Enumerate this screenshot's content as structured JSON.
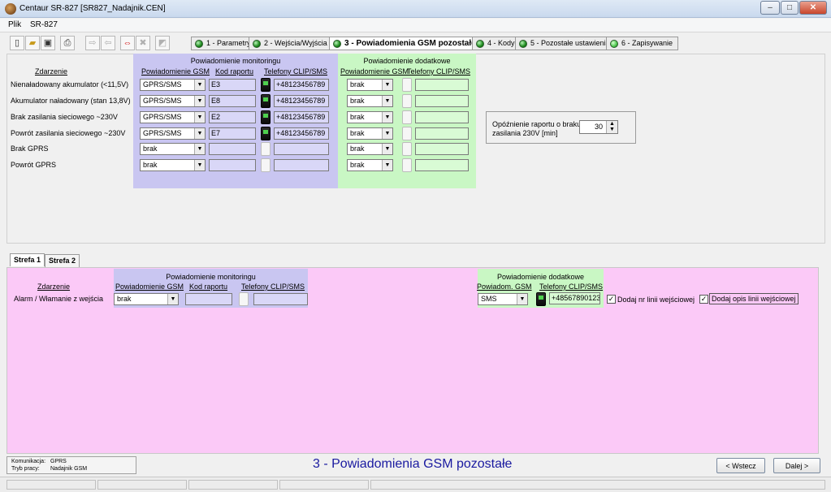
{
  "window": {
    "title": "Centaur SR-827  [SR827_Nadajnik.CEN]",
    "minimize": "–",
    "maximize": "□",
    "close": "✕"
  },
  "menu": [
    "Plik",
    "SR-827"
  ],
  "toolbar": {
    "icons": [
      "new-file-icon",
      "open-folder-icon",
      "save-icon",
      "print-icon",
      "copy-forward-icon",
      "copy-back-icon",
      "exchange-red-icon",
      "cross-gray-icon",
      "export-icon"
    ]
  },
  "steps": [
    {
      "label": "1 - Parametry",
      "active": false
    },
    {
      "label": "2 - Wejścia/Wyjścia",
      "active": false
    },
    {
      "label": "3 - Powiadomienia GSM pozostałe",
      "active": true
    },
    {
      "label": "4 - Kody",
      "active": false
    },
    {
      "label": "5 - Pozostałe ustawienia",
      "active": false
    },
    {
      "label": "6 - Zapisywanie",
      "active": false
    }
  ],
  "upper": {
    "event_header": "Zdarzenie",
    "monitoring_title": "Powiadomienie monitoringu",
    "monitoring_cols": [
      "Powiadomienie GSM",
      "Kod raportu",
      "Telefony CLIP/SMS"
    ],
    "extra_title": "Powiadomienie dodatkowe",
    "extra_cols": [
      "Powiadomienie GSM",
      "Telefony CLIP/SMS"
    ],
    "rows": [
      {
        "event": "Nienaładowany akumulator (<11,5V)",
        "gsm": "GPRS/SMS",
        "code": "E3",
        "phone_on": true,
        "phones": "+48123456789",
        "extra_gsm": "brak",
        "extra_phones": ""
      },
      {
        "event": "Akumulator naładowany (stan 13,8V)",
        "gsm": "GPRS/SMS",
        "code": "E8",
        "phone_on": true,
        "phones": "+48123456789",
        "extra_gsm": "brak",
        "extra_phones": ""
      },
      {
        "event": "Brak zasilania sieciowego ~230V",
        "gsm": "GPRS/SMS",
        "code": "E2",
        "phone_on": true,
        "phones": "+48123456789",
        "extra_gsm": "brak",
        "extra_phones": ""
      },
      {
        "event": "Powrót zasilania sieciowego ~230V",
        "gsm": "GPRS/SMS",
        "code": "E7",
        "phone_on": true,
        "phones": "+48123456789",
        "extra_gsm": "brak",
        "extra_phones": ""
      },
      {
        "event": "Brak GPRS",
        "gsm": "brak",
        "code": "",
        "phone_on": false,
        "phones": "",
        "extra_gsm": "brak",
        "extra_phones": ""
      },
      {
        "event": "Powrót GPRS",
        "gsm": "brak",
        "code": "",
        "phone_on": false,
        "phones": "",
        "extra_gsm": "brak",
        "extra_phones": ""
      }
    ],
    "delay_label": "Opóźnienie raportu o braku zasilania 230V [min]",
    "delay_value": "30"
  },
  "zones": {
    "tabs": [
      "Strefa 1",
      "Strefa 2"
    ],
    "event_header": "Zdarzenie",
    "monitoring_title": "Powiadomienie monitoringu",
    "monitoring_cols": [
      "Powiadomienie GSM",
      "Kod raportu",
      "Telefony CLIP/SMS"
    ],
    "extra_title": "Powiadomienie dodatkowe",
    "extra_cols": [
      "Powiadom. GSM",
      "Telefony CLIP/SMS"
    ],
    "row": {
      "event": "Alarm / Włamanie z wejścia",
      "gsm": "brak",
      "code": "",
      "phones": "",
      "extra_gsm": "SMS",
      "extra_phones": "+48567890123"
    },
    "check1": "Dodaj nr linii wejściowej",
    "check2": "Dodaj opis linii wejściowej"
  },
  "footer": {
    "comm_label": "Komunikacja:",
    "comm_value": "GPRS",
    "mode_label": "Tryb pracy:",
    "mode_value": "Nadajnik GSM",
    "page_title": "3 - Powiadomienia GSM pozostałe",
    "back": "< Wstecz",
    "next": "Dalej >"
  },
  "colors": {
    "blue_panel": "#c9c6f1",
    "green_panel": "#c9f7c4",
    "pink_panel": "#fbc9f7",
    "title_blue": "#1a1aa0"
  }
}
